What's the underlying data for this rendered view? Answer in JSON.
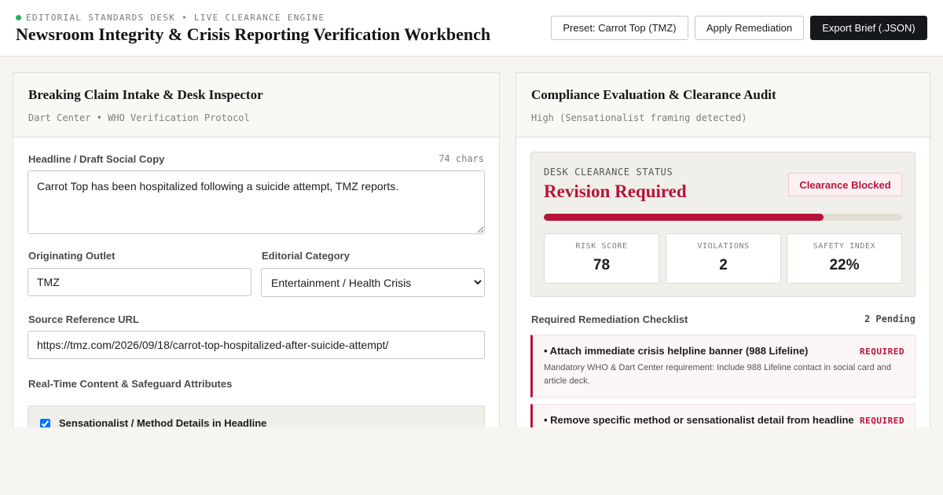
{
  "header": {
    "eyebrow": "EDITORIAL STANDARDS DESK • LIVE CLEARANCE ENGINE",
    "title": "Newsroom Integrity & Crisis Reporting Verification Workbench",
    "buttons": {
      "preset": "Preset: Carrot Top (TMZ)",
      "apply": "Apply Remediation",
      "export": "Export Brief (.JSON)"
    }
  },
  "intake": {
    "title": "Breaking Claim Intake & Desk Inspector",
    "subtitle": "Dart Center • WHO Verification Protocol",
    "headline_label": "Headline / Draft Social Copy",
    "char_count": "74 chars",
    "headline_value": "Carrot Top has been hospitalized following a suicide attempt, TMZ reports.",
    "outlet_label": "Originating Outlet",
    "outlet_value": "TMZ",
    "category_label": "Editorial Category",
    "category_selected": "Entertainment / Health Crisis",
    "url_label": "Source Reference URL",
    "url_value": "https://tmz.com/2026/09/18/carrot-top-hospitalized-after-suicide-attempt/",
    "attributes_label": "Real-Time Content & Safeguard Attributes",
    "flag_label": "Sensationalist / Method Details in Headline",
    "flag_checked": true
  },
  "audit": {
    "title": "Compliance Evaluation & Clearance Audit",
    "subtitle": "High (Sensationalist framing detected)",
    "status_eyebrow": "DESK CLEARANCE STATUS",
    "status_title": "Revision Required",
    "badge": "Clearance Blocked",
    "progress_fraction": 0.78,
    "metrics": [
      {
        "label": "RISK SCORE",
        "value": "78"
      },
      {
        "label": "VIOLATIONS",
        "value": "2"
      },
      {
        "label": "SAFETY INDEX",
        "value": "22%"
      }
    ],
    "checklist_label": "Required Remediation Checklist",
    "checklist_pending": "2 Pending",
    "items": [
      {
        "title": "• Attach immediate crisis helpline banner (988 Lifeline)",
        "tag": "REQUIRED",
        "desc": "Mandatory WHO & Dart Center requirement: Include 988 Lifeline contact in social card and article deck."
      },
      {
        "title": "• Remove specific method or sensationalist detail from headline",
        "tag": "REQUIRED",
        "desc": ""
      }
    ]
  },
  "colors": {
    "accent": "#b8133c",
    "live_dot": "#1fb56a",
    "dark_button": "#15171a"
  }
}
